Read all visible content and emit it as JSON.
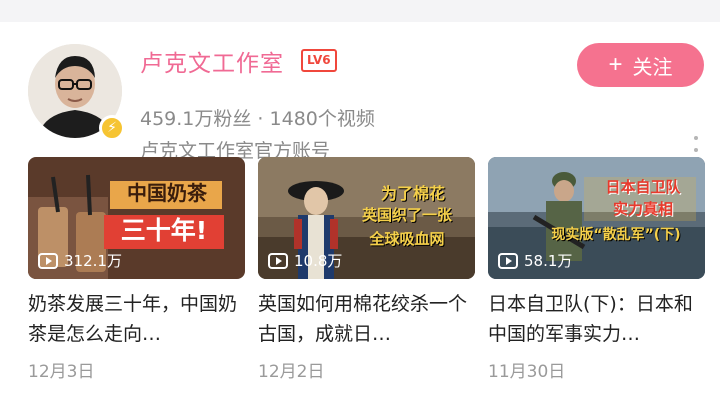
{
  "channel": {
    "name": "卢克文工作室",
    "level": "LV6",
    "stats": "459.1万粉丝 · 1480个视频",
    "description": "卢克文工作室官方账号",
    "follow_label": "关注",
    "verified_icon": "lightning-icon"
  },
  "videos": [
    {
      "overlay": [
        "中国奶茶",
        "三十年!"
      ],
      "plays": "312.1万",
      "title": "奶茶发展三十年，中国奶茶是怎么走向…",
      "date": "12月3日"
    },
    {
      "overlay": [
        "为了棉花",
        "英国织了一张",
        "全球吸血网"
      ],
      "plays": "10.8万",
      "title": "英国如何用棉花绞杀一个古国，成就日…",
      "date": "12月2日"
    },
    {
      "overlay": [
        "日本自卫队",
        "实力真相",
        "现实版“散乱军”(下)"
      ],
      "plays": "58.1万",
      "title": "日本自卫队(下)：日本和中国的军事实力…",
      "date": "11月30日"
    }
  ],
  "colors": {
    "accent": "#f06a94",
    "follow_bg": "#f5728f",
    "level_badge": "#f0473c",
    "verified": "#f6c432"
  }
}
